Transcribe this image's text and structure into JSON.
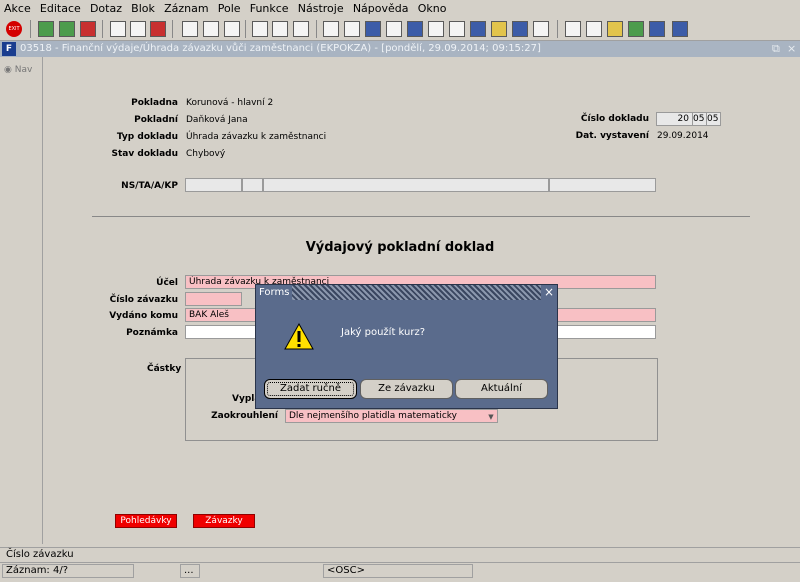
{
  "menu": [
    "Akce",
    "Editace",
    "Dotaz",
    "Blok",
    "Záznam",
    "Pole",
    "Funkce",
    "Nástroje",
    "Nápověda",
    "Okno"
  ],
  "toolbar": {
    "exit_label": "EXIT"
  },
  "window": {
    "logo": "F",
    "title": "03518 - Finanční výdaje/Úhrada závazku vůči zaměstnanci (EKPOKZA) - [pondělí, 29.09.2014; 09:15:27]",
    "restore": "⧉",
    "close": "×"
  },
  "nav": {
    "label": "Nav"
  },
  "header": {
    "pokladna_label": "Pokladna",
    "pokladna_value": "Korunová - hlavní 2",
    "pokladni_label": "Pokladní",
    "pokladni_value": "Daňková Jana",
    "typ_label": "Typ dokladu",
    "typ_value": "Úhrada závazku k zaměstnanci",
    "stav_label": "Stav dokladu",
    "stav_value": "Chybový",
    "cislo_label": "Číslo dokladu",
    "cislo_values": [
      "20",
      "05",
      "05"
    ],
    "dat_label": "Dat. vystavení",
    "dat_value": "29.09.2014",
    "ns_label": "NS/TA/A/KP"
  },
  "form": {
    "heading": "Výdajový pokladní doklad",
    "ucel_label": "Účel",
    "ucel_value": "Úhrada závazku k zaměstnanci",
    "cislo_zavazku_label": "Číslo závazku",
    "cislo_zavazku_value": "",
    "vydano_label": "Vydáno komu",
    "vydano_value": "BAK Aleš",
    "poznamka_label": "Poznámka",
    "poznamka_value": "",
    "castky_label": "Částky",
    "vypla_label": "Vypla",
    "zaokrouhleni_label": "Zaokrouhlení",
    "zaokrouhleni_value": "Dle nejmenšího platidla matematicky"
  },
  "buttons": {
    "pohledavky": "Pohledávky",
    "zavazky": "Závazky"
  },
  "dialog": {
    "title": "Forms",
    "close": "×",
    "message": "Jaký použít kurz?",
    "btn_manual": "Zadat ručně",
    "btn_zavazku": "Ze závazku",
    "btn_aktualni": "Aktuální"
  },
  "status": {
    "hint": "Číslo závazku",
    "record": "Záznam: 4/?",
    "dots": "...",
    "osc": "<OSC>"
  }
}
